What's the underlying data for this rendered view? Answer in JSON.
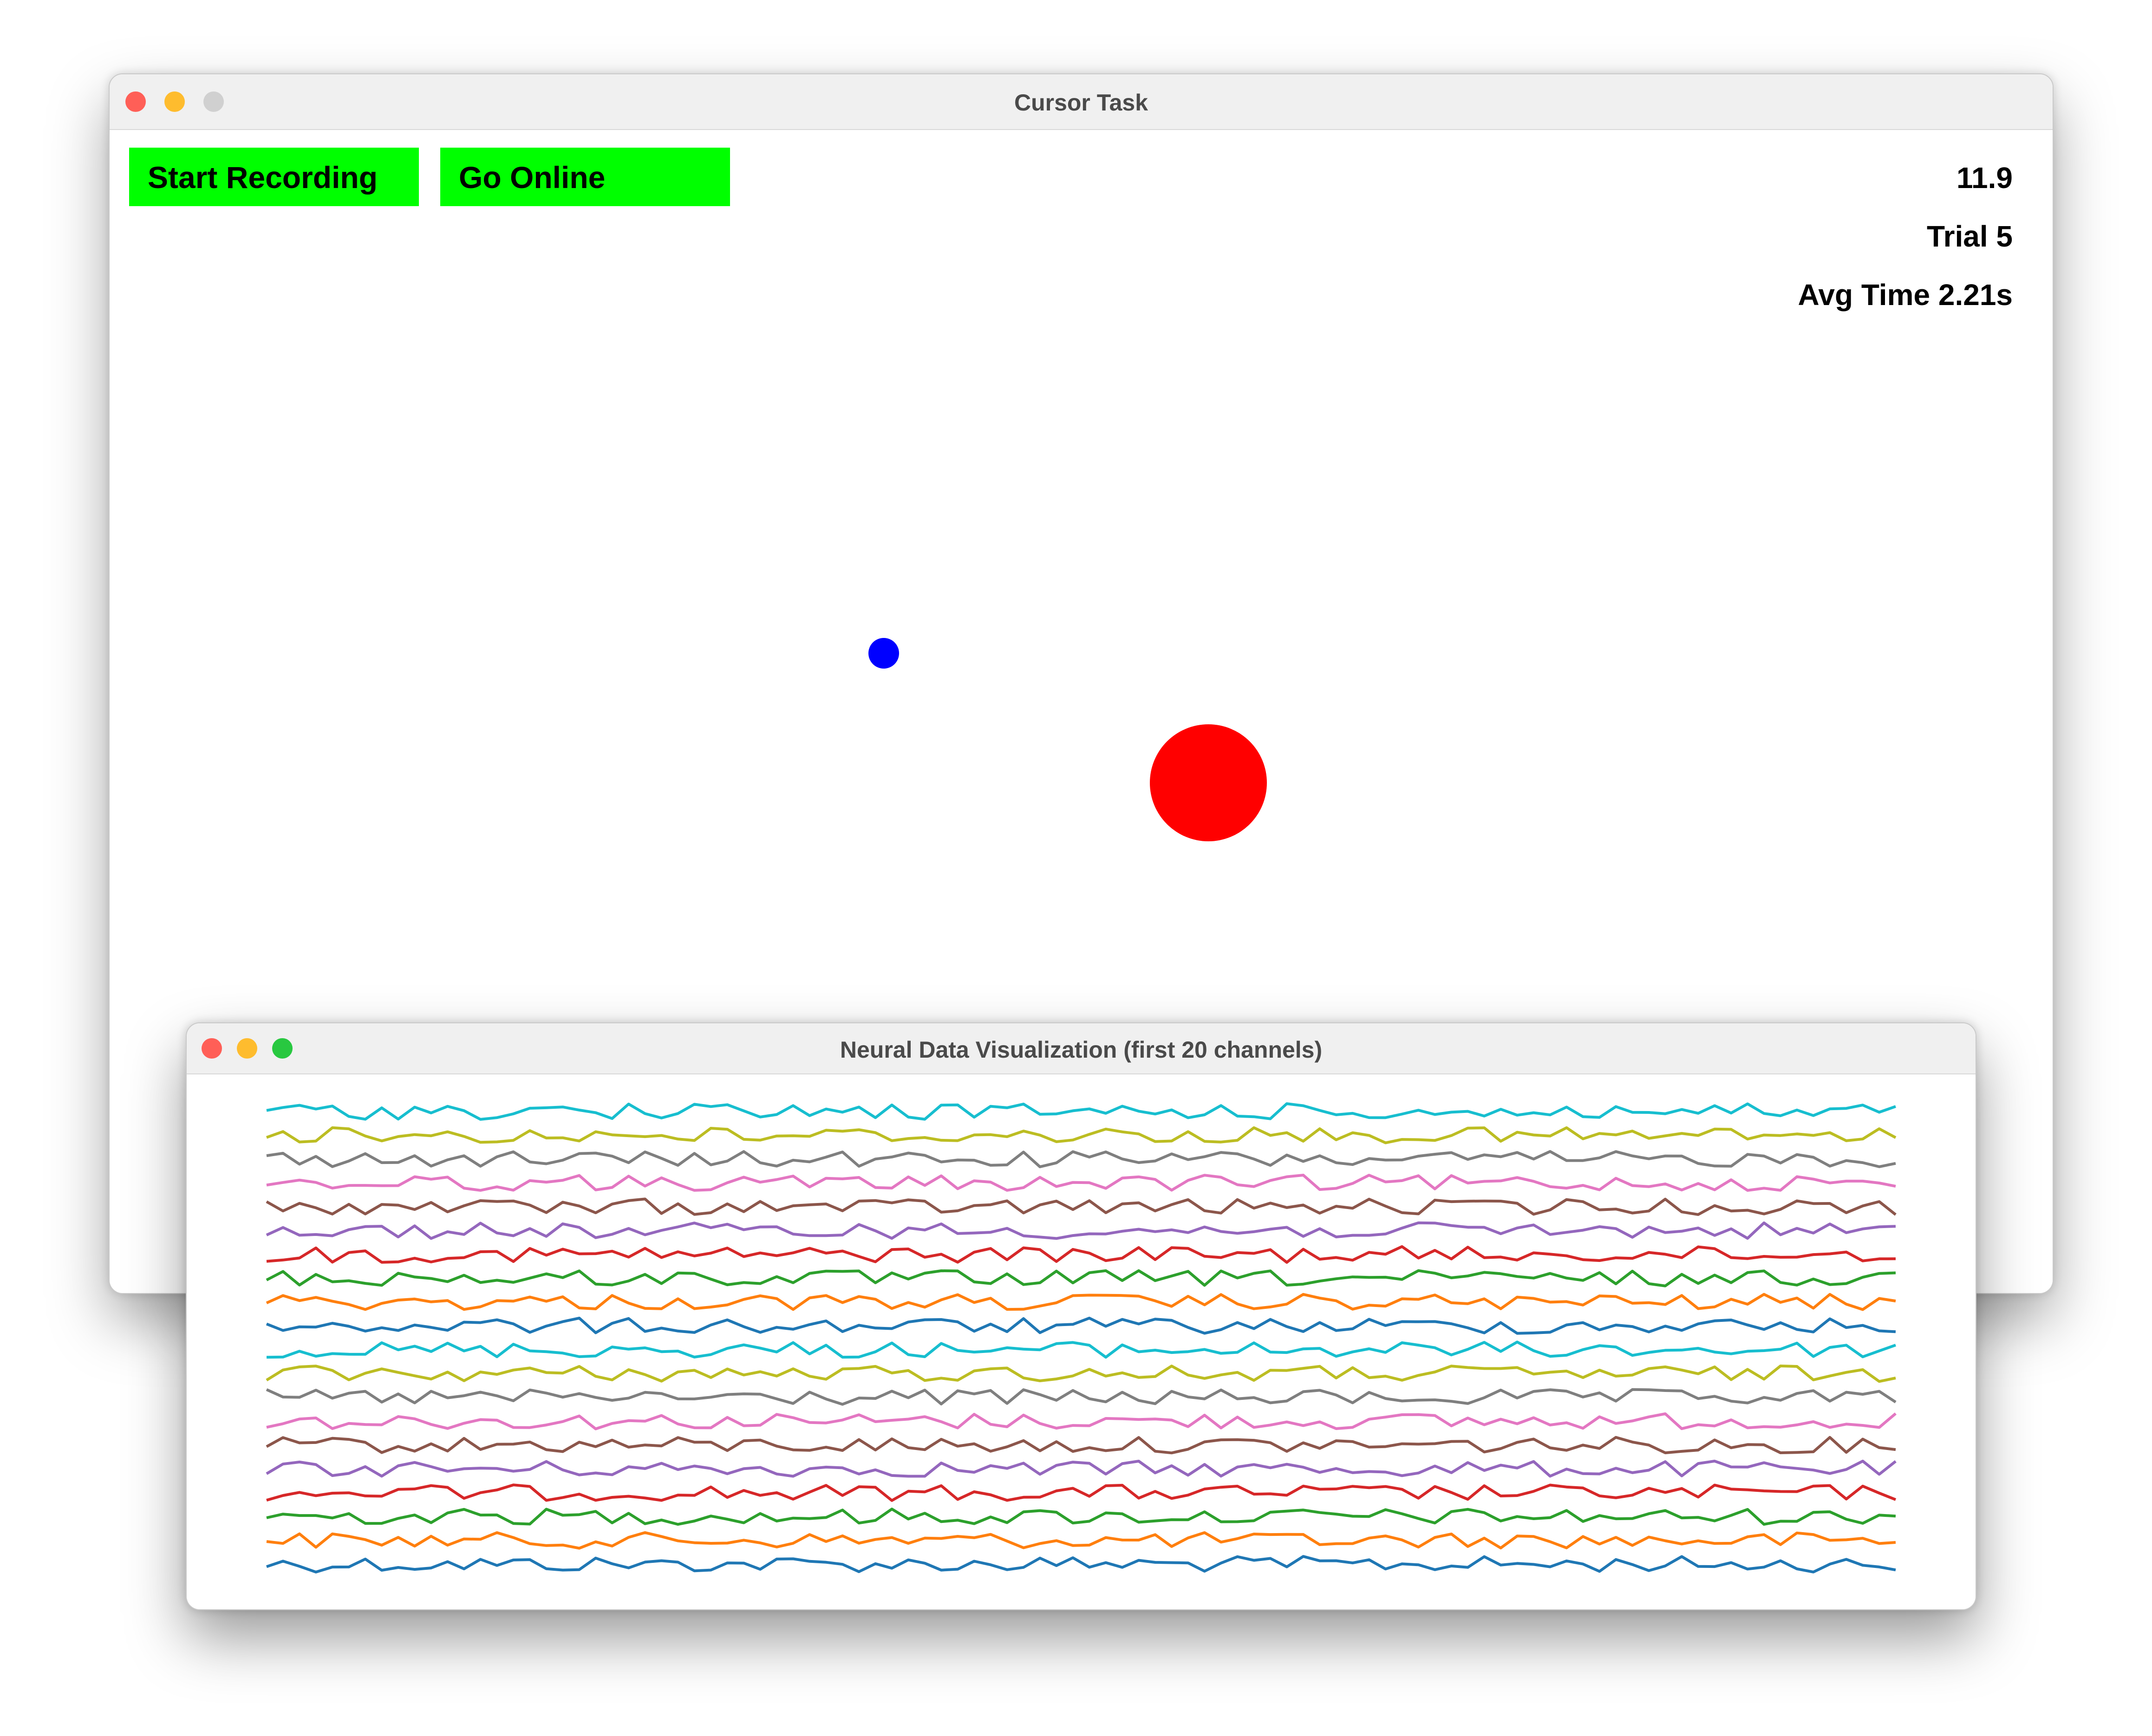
{
  "cursor_window": {
    "title": "Cursor Task",
    "buttons": {
      "start_recording": "Start Recording",
      "go_online": "Go Online"
    },
    "stats": {
      "value": "11.9",
      "trial": "Trial 5",
      "avg_time": "Avg Time 2.21s"
    },
    "cursor_color": "#0000ff",
    "target_color": "#ff0000",
    "button_color": "#00ff00"
  },
  "neural_window": {
    "title": "Neural Data Visualization (first 20 channels)"
  },
  "window_controls": {
    "close": "#ff5f57",
    "minimize": "#febc2e",
    "zoom": "#28c840",
    "zoom_inactive": "#d0d0d0"
  },
  "chart_data": {
    "type": "line",
    "channel_count": 20,
    "samples_per_channel": 100,
    "series_colors": [
      "#1f77b4",
      "#ff7f0e",
      "#2ca02c",
      "#d62728",
      "#9467bd",
      "#8c564b",
      "#e377c2",
      "#7f7f7f",
      "#bcbd22",
      "#17becf",
      "#1f77b4",
      "#ff7f0e",
      "#2ca02c",
      "#d62728",
      "#9467bd",
      "#8c564b",
      "#e377c2",
      "#7f7f7f",
      "#bcbd22",
      "#17becf"
    ]
  }
}
